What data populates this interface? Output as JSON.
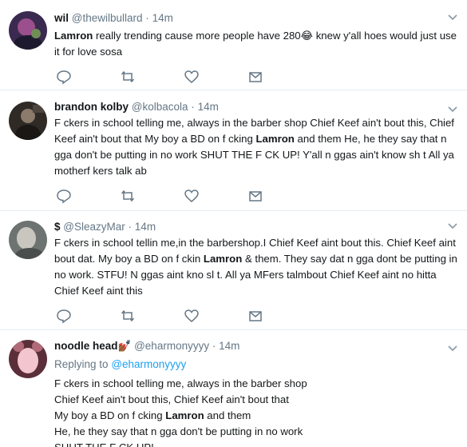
{
  "tweets": [
    {
      "name": "wil",
      "handle": "@thewilbullard",
      "time": "14m",
      "text_parts": [
        "Lamron",
        " really trending cause more people have 280",
        "😂",
        " knew y'all hoes would just use it for love sosa"
      ],
      "avatar_colors": [
        "#3a2a4f",
        "#9b4f8c",
        "#1e1a2e"
      ]
    },
    {
      "name": "brandon kolby",
      "handle": "@kolbacola",
      "time": "14m",
      "text_parts": [
        "F ckers in school telling me, always in the barber shop Chief Keef ain't bout this, Chief Keef ain't bout that My boy a BD on f  cking ",
        "Lamron",
        " and them He, he they say that n gga don't be putting in no work SHUT THE F  CK UP! Y'all n  ggas ain't know sh t All ya motherf   kers talk ab"
      ],
      "avatar_colors": [
        "#2f2a26",
        "#8c7a6a",
        "#1a1714"
      ]
    },
    {
      "name": "$",
      "handle": "@SleazyMar",
      "time": "14m",
      "text_parts": [
        "F  ckers in school tellin me,in the barbershop.I Chief Keef aint bout this. Chief Keef aint bout dat. My boy a BD on f  ckin ",
        "Lamron",
        " & them. They say dat n gga dont be putting in no work. STFU! N ggas aint kno sl  t. All ya MFers talmbout Chief Keef aint no hitta Chief Keef aint this"
      ],
      "avatar_colors": [
        "#6d7370",
        "#c9c6bf",
        "#4a4e4c"
      ]
    },
    {
      "name": "noodle head",
      "name_emoji": "💅🏾",
      "handle": "@eharmonyyyy",
      "time": "14m",
      "replying_label": "Replying to",
      "replying_handle": "@eharmonyyyy",
      "lines": [
        "F  ckers in school telling me, always in the barber shop",
        "Chief Keef ain't bout this, Chief Keef ain't bout that",
        [
          "My boy a BD on f  cking ",
          "Lamron",
          " and them"
        ],
        "He, he they say that n gga don't be putting in no work",
        "SHUT THE F  CK UP!"
      ],
      "avatar_colors": [
        "#b06a78",
        "#f3c6cf",
        "#5a2f3a"
      ]
    }
  ],
  "icons": {
    "reply": "reply-icon",
    "retweet": "retweet-icon",
    "like": "heart-icon",
    "dm": "envelope-icon",
    "menu": "chevron-down-icon"
  },
  "colors": {
    "text": "#14171a",
    "muted": "#657786",
    "icon": "#657786",
    "link": "#1da1f2",
    "divider": "#e6ecf0"
  }
}
